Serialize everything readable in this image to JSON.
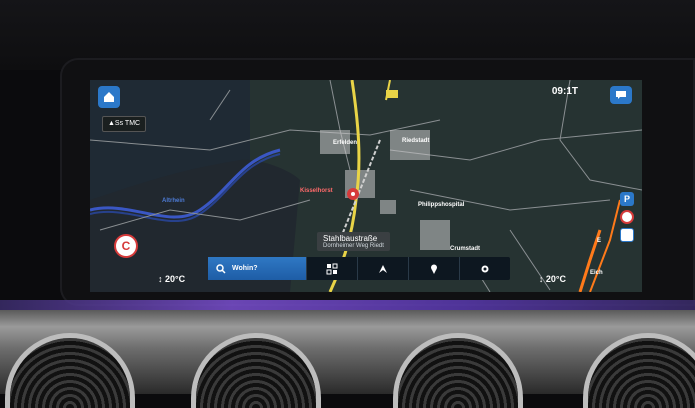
{
  "status": {
    "time": "09:1T",
    "traffic": "▲Ss TMC"
  },
  "temperatures": {
    "left": "↕ 20°C",
    "right": "↕ 20°C"
  },
  "map": {
    "places": [
      "Erfelden",
      "Riedstadt",
      "Kisselhorst",
      "Philippshospital",
      "Crumstadt",
      "Altrhein"
    ],
    "side_letters": [
      "E",
      "Eich"
    ]
  },
  "street": {
    "name": "Stahlbaustraße",
    "sub": "Dornheimer Weg Riedt"
  },
  "bottom_bar": {
    "search_label": "Wohin?",
    "buttons": [
      "POI",
      "Umleitung",
      "Favoriten",
      "Einstellungen"
    ]
  },
  "colors": {
    "accent": "#2b78c9",
    "route_red": "#d63a3a",
    "highway": "#e9d447"
  }
}
